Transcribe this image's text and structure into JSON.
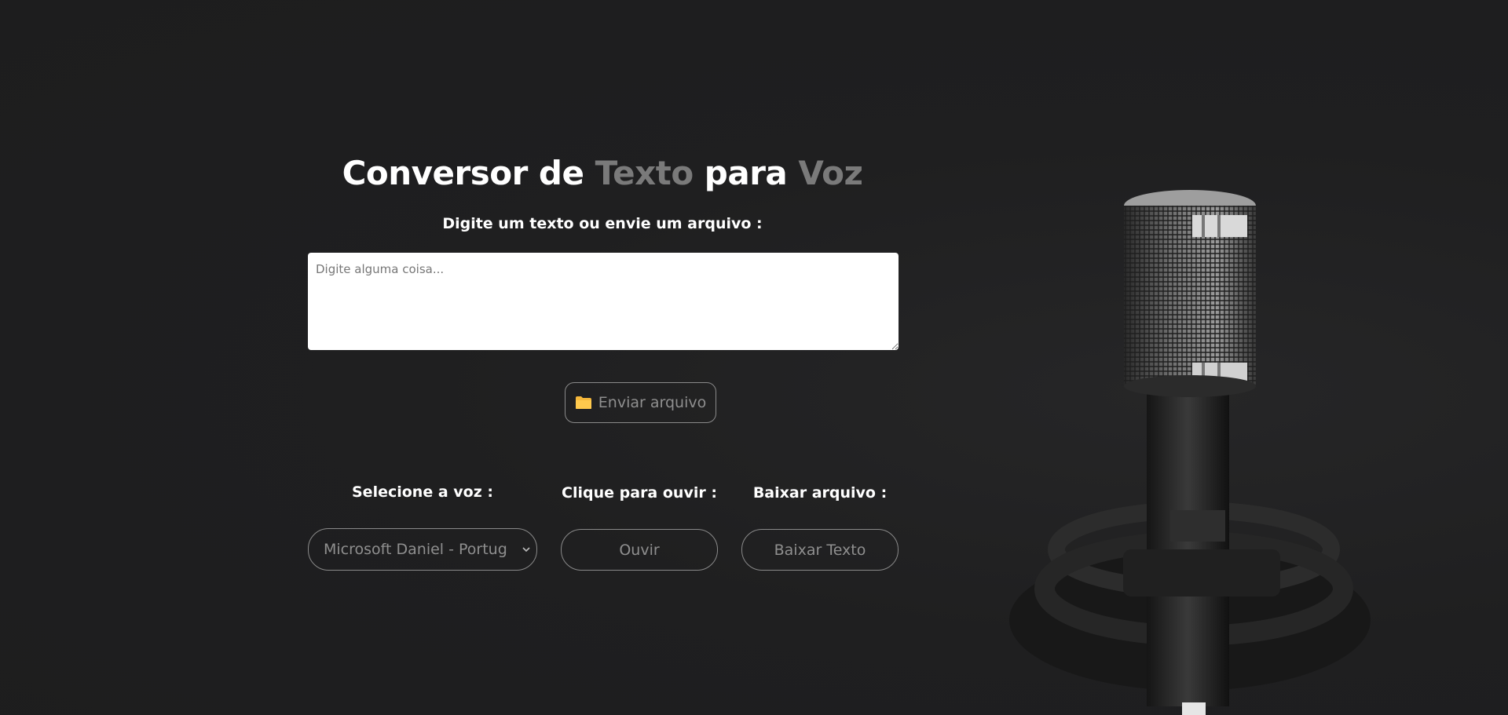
{
  "header": {
    "title_part1": "Conversor de ",
    "title_part2": "Texto",
    "title_part3": " para ",
    "title_part4": "Voz",
    "subtitle": "Digite um texto ou envie um arquivo :"
  },
  "text_input": {
    "placeholder": "Digite alguma coisa...",
    "value": ""
  },
  "upload": {
    "icon": "folder-icon",
    "label": "Enviar arquivo"
  },
  "controls": {
    "voice_label": "Selecione a voz :",
    "voice_selected": "Microsoft Daniel - Portuguese (Brazil)",
    "listen_label": "Clique para ouvir :",
    "listen_button": "Ouvir",
    "download_label": "Baixar arquivo :",
    "download_button": "Baixar Texto"
  },
  "colors": {
    "background": "#1e1e1f",
    "title_white": "#ffffff",
    "title_gray": "#7a7a7a",
    "border": "#8a8a8a",
    "button_text": "#8f8f8f",
    "folder_icon": "#f5b73b"
  }
}
